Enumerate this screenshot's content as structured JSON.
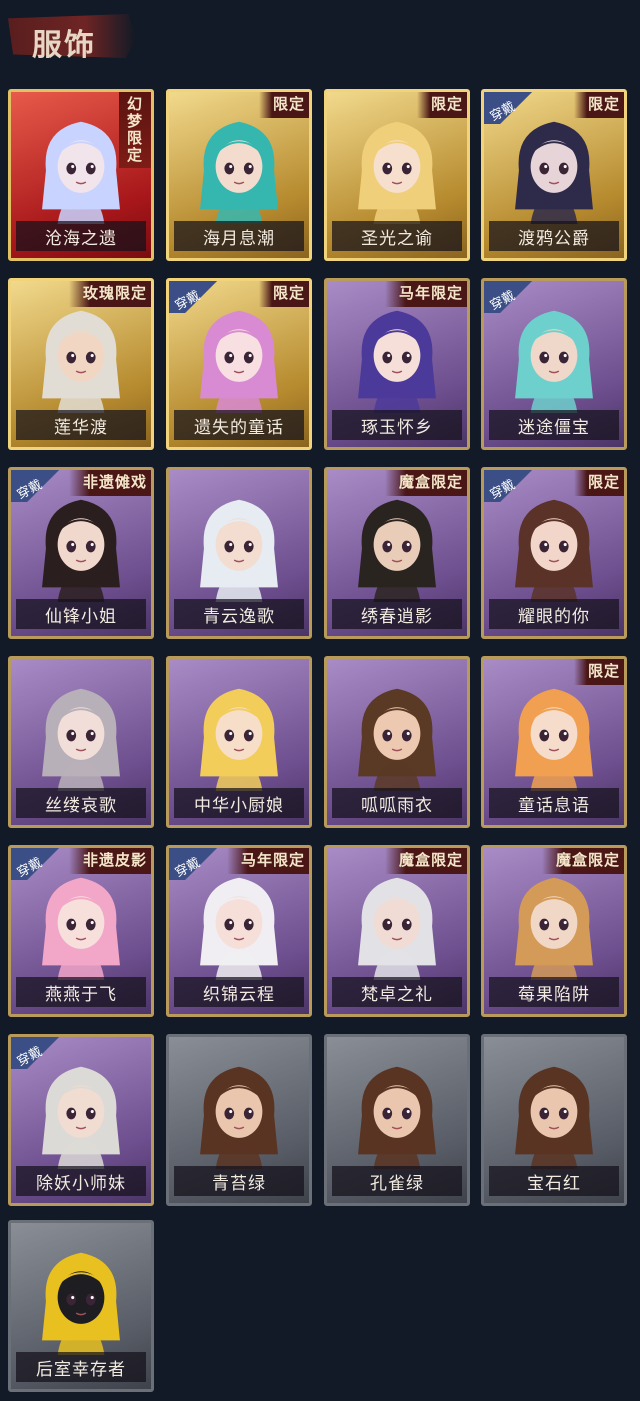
{
  "header": {
    "title": "服饰"
  },
  "labels": {
    "wear_badge": "穿戴"
  },
  "colors": {
    "background": "#111a26",
    "gold_border": "#d6b45a",
    "wear_badge": "#3b4f86",
    "tag_bg": "#4a1616"
  },
  "outfits": [
    {
      "name": "沧海之遗",
      "style": "red",
      "tag": "幻梦限定",
      "wearing": false,
      "hair": "#c8d4ff",
      "skin": "#f1e4ea"
    },
    {
      "name": "海月息潮",
      "style": "gold",
      "tag": "限定",
      "wearing": false,
      "hair": "#35b7b0",
      "skin": "#f3dccd"
    },
    {
      "name": "圣光之谕",
      "style": "gold",
      "tag": "限定",
      "wearing": false,
      "hair": "#f0cf7a",
      "skin": "#f6dfcd"
    },
    {
      "name": "渡鸦公爵",
      "style": "gold",
      "tag": "限定",
      "wearing": true,
      "hair": "#2e2a4a",
      "skin": "#e6d4d8"
    },
    {
      "name": "莲华渡",
      "style": "gold",
      "tag": "玫瑰限定",
      "wearing": false,
      "hair": "#e2ddd4",
      "skin": "#f1d7c3"
    },
    {
      "name": "遗失的童话",
      "style": "gold",
      "tag": "限定",
      "wearing": true,
      "hair": "#d88ad2",
      "skin": "#f7dfe2"
    },
    {
      "name": "琢玉怀乡",
      "style": "purple",
      "tag": "马年限定",
      "wearing": false,
      "hair": "#4c3a9a",
      "skin": "#f5dfd8"
    },
    {
      "name": "迷途僵宝",
      "style": "purple",
      "tag": "",
      "wearing": true,
      "hair": "#6ed0cc",
      "skin": "#efd7c9"
    },
    {
      "name": "仙锋小姐",
      "style": "purple",
      "tag": "非遗傩戏",
      "wearing": true,
      "hair": "#2a1e1e",
      "skin": "#f0d8cc"
    },
    {
      "name": "青云逸歌",
      "style": "purple",
      "tag": "",
      "wearing": false,
      "hair": "#e6ecf2",
      "skin": "#f2ddd0"
    },
    {
      "name": "绣春逍影",
      "style": "purple",
      "tag": "魔盒限定",
      "wearing": false,
      "hair": "#2a2420",
      "skin": "#e9cdb8"
    },
    {
      "name": "耀眼的你",
      "style": "purple",
      "tag": "限定",
      "wearing": true,
      "hair": "#5a3228",
      "skin": "#f2d6ca"
    },
    {
      "name": "丝缕哀歌",
      "style": "purple",
      "tag": "",
      "wearing": false,
      "hair": "#b8b0b8",
      "skin": "#f1ded8"
    },
    {
      "name": "中华小厨娘",
      "style": "purple",
      "tag": "",
      "wearing": false,
      "hair": "#f2cd5a",
      "skin": "#f6dec9"
    },
    {
      "name": "呱呱雨衣",
      "style": "purple",
      "tag": "",
      "wearing": false,
      "hair": "#5a3a24",
      "skin": "#ecc9b0"
    },
    {
      "name": "童话息语",
      "style": "purple",
      "tag": "限定",
      "wearing": false,
      "hair": "#f0a050",
      "skin": "#f6dccb"
    },
    {
      "name": "燕燕于飞",
      "style": "purple",
      "tag": "非遗皮影",
      "wearing": true,
      "hair": "#f2a6c8",
      "skin": "#f7e0dc"
    },
    {
      "name": "织锦云程",
      "style": "purple",
      "tag": "马年限定",
      "wearing": true,
      "hair": "#f0eef2",
      "skin": "#f5dfd8"
    },
    {
      "name": "梵卓之礼",
      "style": "purple",
      "tag": "魔盒限定",
      "wearing": false,
      "hair": "#e2e2e6",
      "skin": "#f0dcd4"
    },
    {
      "name": "莓果陷阱",
      "style": "purple",
      "tag": "魔盒限定",
      "wearing": false,
      "hair": "#d49a58",
      "skin": "#f1d8c6"
    },
    {
      "name": "除妖小师妹",
      "style": "purple",
      "tag": "",
      "wearing": true,
      "hair": "#dcdad6",
      "skin": "#f0dcd0"
    },
    {
      "name": "青苔绿",
      "style": "gray",
      "tag": "",
      "wearing": false,
      "hair": "#5a3422",
      "skin": "#eac6ae"
    },
    {
      "name": "孔雀绿",
      "style": "gray",
      "tag": "",
      "wearing": false,
      "hair": "#5a3422",
      "skin": "#eac6ae"
    },
    {
      "name": "宝石红",
      "style": "gray",
      "tag": "",
      "wearing": false,
      "hair": "#5a3422",
      "skin": "#eac6ae"
    },
    {
      "name": "后室幸存者",
      "style": "gray",
      "tag": "",
      "wearing": false,
      "hair": "#e8c020",
      "skin": "#1e1e22"
    }
  ]
}
